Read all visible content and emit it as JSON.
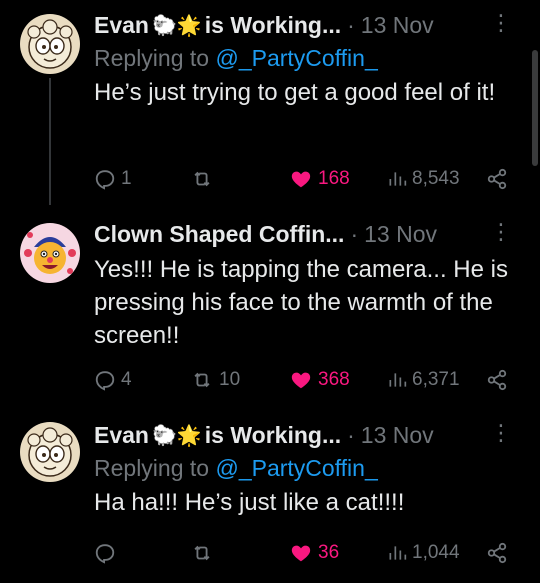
{
  "tweets": [
    {
      "author": "Evan",
      "author_emojis": "🐑🌟",
      "author_suffix": "is Working...",
      "date": "13 Nov",
      "replying_prefix": "Replying to",
      "replying_handle": "@_PartyCoffin_",
      "text": "He’s just trying to get a good feel of it!",
      "replies": "1",
      "retweets": "",
      "likes": "168",
      "views": "8,543",
      "avatar_icon": "sheep-cartoon-avatar"
    },
    {
      "author": "Clown Shaped Coffin...",
      "date": "13 Nov",
      "text": "Yes!!! He is tapping the camera... He is pressing his face to the warmth of the screen!!",
      "replies": "4",
      "retweets": "10",
      "likes": "368",
      "views": "6,371",
      "avatar_icon": "clown-cartoon-avatar"
    },
    {
      "author": "Evan",
      "author_emojis": "🐑🌟",
      "author_suffix": "is Working...",
      "date": "13 Nov",
      "replying_prefix": "Replying to",
      "replying_handle": "@_PartyCoffin_",
      "text": "Ha ha!!! He’s just like a cat!!!!",
      "replies": "",
      "retweets": "",
      "likes": "36",
      "views": "1,044",
      "avatar_icon": "sheep-cartoon-avatar"
    }
  ],
  "separator": "·",
  "more_icon": "⋮",
  "colors": {
    "background": "#000000",
    "text": "#e7e9ea",
    "muted": "#71767b",
    "link": "#1d9bf0",
    "like": "#f91880"
  }
}
